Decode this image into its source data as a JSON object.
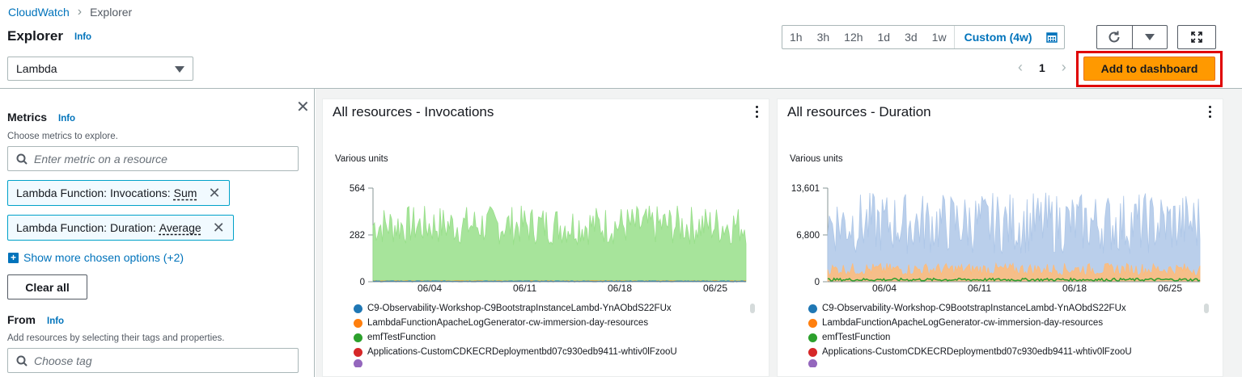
{
  "breadcrumb": {
    "root": "CloudWatch",
    "current": "Explorer"
  },
  "page": {
    "title": "Explorer",
    "info": "Info"
  },
  "namespace_select": {
    "value": "Lambda"
  },
  "time_range": {
    "options": [
      "1h",
      "3h",
      "12h",
      "1d",
      "3d",
      "1w"
    ],
    "custom": "Custom (4w)"
  },
  "pager": {
    "page": "1"
  },
  "actions": {
    "add_to_dashboard": "Add to dashboard"
  },
  "metrics_panel": {
    "title": "Metrics",
    "info": "Info",
    "description": "Choose metrics to explore.",
    "search_placeholder": "Enter metric on a resource",
    "tokens": [
      {
        "label": "Lambda Function: Invocations:",
        "stat": "Sum"
      },
      {
        "label": "Lambda Function: Duration:",
        "stat": "Average"
      }
    ],
    "show_more": "Show more chosen options (+2)",
    "clear_all": "Clear all"
  },
  "from_panel": {
    "title": "From",
    "info": "Info",
    "description": "Add resources by selecting their tags and properties.",
    "tag_placeholder": "Choose tag"
  },
  "colors": {
    "accent": "#0073bb",
    "primary_button": "#ff9900",
    "highlight": "#e00000",
    "series_blue": "#1f77b4",
    "series_orange": "#ff7f0e",
    "series_green": "#2ca02c",
    "series_red": "#d62728",
    "series_purple": "#9467bd"
  },
  "widgets": [
    {
      "title": "All resources - Invocations",
      "units": "Various units",
      "legend": [
        "C9-Observability-Workshop-C9BootstrapInstanceLambd-YnAObdS22FUx",
        "LambdaFunctionApacheLogGenerator-cw-immersion-day-resources",
        "emfTestFunction",
        "Applications-CustomCDKECRDeploymentbd07c930edb9411-whtiv0lFzooU"
      ]
    },
    {
      "title": "All resources - Duration",
      "units": "Various units",
      "legend": [
        "C9-Observability-Workshop-C9BootstrapInstanceLambd-YnAObdS22FUx",
        "LambdaFunctionApacheLogGenerator-cw-immersion-day-resources",
        "emfTestFunction",
        "Applications-CustomCDKECRDeploymentbd07c930edb9411-whtiv0lFzooU"
      ]
    }
  ],
  "chart_data": [
    {
      "type": "line",
      "title": "All resources - Invocations",
      "ylabel": "Various units",
      "ylim": [
        0,
        564
      ],
      "yticks": [
        "0",
        "282",
        "564"
      ],
      "xticks": [
        "06/04",
        "06/11",
        "06/18",
        "06/25"
      ],
      "series": [
        {
          "name": "C9-Observability-Workshop-C9BootstrapInstanceLambd-YnAObdS22FUx",
          "mean": 2,
          "jitter": 2
        },
        {
          "name": "LambdaFunctionApacheLogGenerator-cw-immersion-day-resources",
          "mean": 3,
          "jitter": 1
        },
        {
          "name": "emfTestFunction",
          "mean": 340,
          "jitter": 120
        },
        {
          "name": "Applications-CustomCDKECRDeploymentbd07c930edb9411-whtiv0lFzooU",
          "mean": 0,
          "jitter": 0
        }
      ]
    },
    {
      "type": "line",
      "title": "All resources - Duration",
      "ylabel": "Various units",
      "ylim": [
        0,
        13601
      ],
      "yticks": [
        "0",
        "6,800",
        "13,601"
      ],
      "xticks": [
        "06/04",
        "06/11",
        "06/18",
        "06/25"
      ],
      "series": [
        {
          "name": "C9-Observability-Workshop-C9BootstrapInstanceLambd-YnAObdS22FUx",
          "mean": 8500,
          "jitter": 4500
        },
        {
          "name": "LambdaFunctionApacheLogGenerator-cw-immersion-day-resources",
          "mean": 1800,
          "jitter": 900
        },
        {
          "name": "emfTestFunction",
          "mean": 300,
          "jitter": 200
        },
        {
          "name": "Applications-CustomCDKECRDeploymentbd07c930edb9411-whtiv0lFzooU",
          "mean": 0,
          "jitter": 0
        }
      ]
    }
  ]
}
